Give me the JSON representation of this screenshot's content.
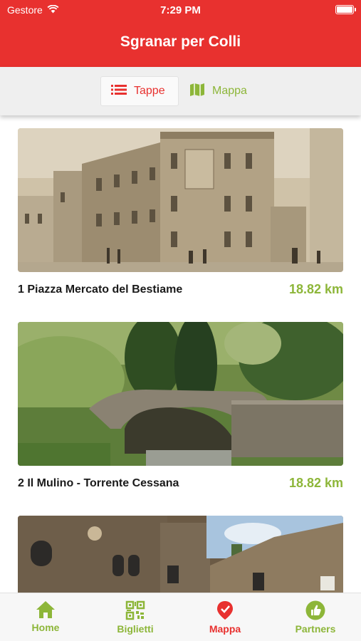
{
  "status_bar": {
    "carrier": "Gestore",
    "time": "7:29 PM"
  },
  "header": {
    "title": "Sgranar per Colli"
  },
  "segments": [
    {
      "label": "Tappe",
      "icon": "list-icon",
      "selected": true
    },
    {
      "label": "Mappa",
      "icon": "map-icon",
      "selected": false
    }
  ],
  "stages": [
    {
      "title": "1 Piazza Mercato del Bestiame",
      "distance": "18.82 km",
      "image": "historic-sepia-square-photo"
    },
    {
      "title": "2 Il Mulino - Torrente Cessana",
      "distance": "18.82 km",
      "image": "stone-bridge-stream-photo"
    },
    {
      "title": "",
      "distance": "",
      "image": "stone-buildings-photo"
    }
  ],
  "tabbar": [
    {
      "label": "Home",
      "icon": "home-icon"
    },
    {
      "label": "Biglietti",
      "icon": "qr-code-icon"
    },
    {
      "label": "Mappa",
      "icon": "map-pin-icon",
      "active": true
    },
    {
      "label": "Partners",
      "icon": "thumbs-up-icon"
    }
  ],
  "colors": {
    "brand_red": "#e8312f",
    "accent_green": "#8db639"
  }
}
